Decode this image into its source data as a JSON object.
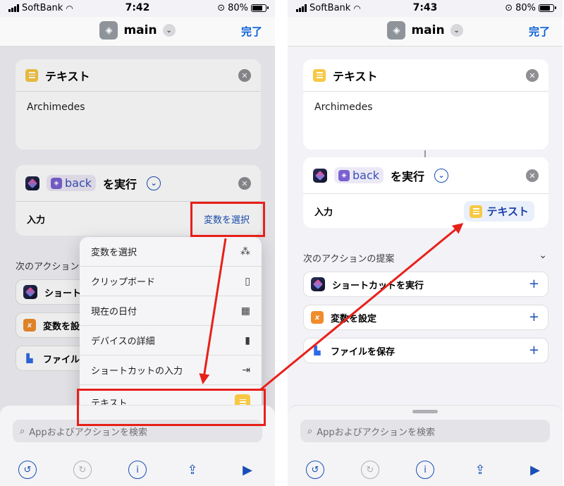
{
  "left_screen": {
    "status": {
      "carrier": "SoftBank",
      "time": "7:42",
      "battery": "80%"
    },
    "nav": {
      "title": "main",
      "done": "完了"
    },
    "text_card": {
      "title": "テキスト",
      "value": "Archimedes"
    },
    "run_card": {
      "token": "back",
      "suffix": "を実行",
      "input_label": "入力",
      "select_var": "変数を選択"
    },
    "suggestions_label": "次のアクション",
    "suggestions": [
      "ショート",
      "変数を設",
      "ファイル"
    ],
    "menu": [
      {
        "label": "変数を選択",
        "icon": "magic-wand-icon"
      },
      {
        "label": "クリップボード",
        "icon": "clipboard-icon"
      },
      {
        "label": "現在の日付",
        "icon": "calendar-icon"
      },
      {
        "label": "デバイスの詳細",
        "icon": "phone-icon"
      },
      {
        "label": "ショートカットの入力",
        "icon": "enter-icon"
      },
      {
        "label": "テキスト",
        "icon": "text-icon"
      }
    ],
    "search_placeholder": "Appおよびアクションを検索"
  },
  "right_screen": {
    "status": {
      "carrier": "SoftBank",
      "time": "7:43",
      "battery": "80%"
    },
    "nav": {
      "title": "main",
      "done": "完了"
    },
    "text_card": {
      "title": "テキスト",
      "value": "Archimedes"
    },
    "run_card": {
      "token": "back",
      "suffix": "を実行",
      "input_label": "入力",
      "input_value": "テキスト"
    },
    "suggestions_label": "次のアクションの提案",
    "suggestions": [
      "ショートカットを実行",
      "変数を設定",
      "ファイルを保存"
    ],
    "search_placeholder": "Appおよびアクションを検索"
  },
  "colors": {
    "annotation": "#e8201a",
    "accent": "#1a4fb6",
    "text_icon": "#f7c843"
  }
}
